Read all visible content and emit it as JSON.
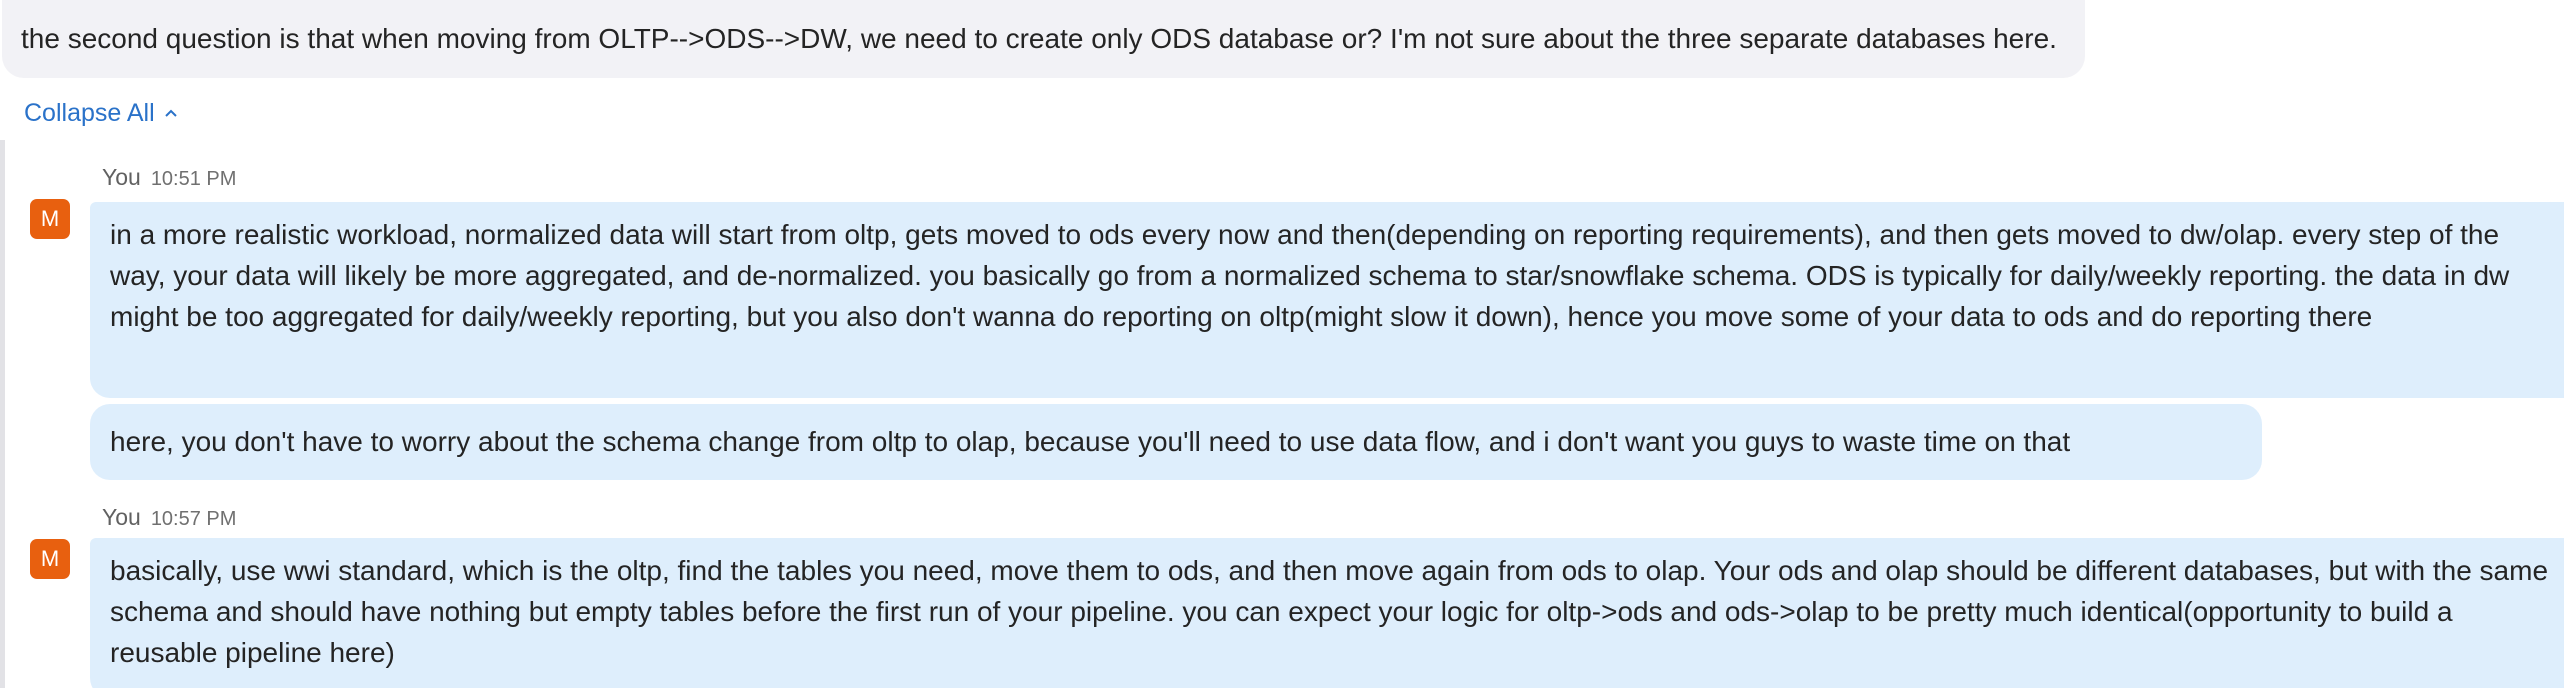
{
  "question": {
    "text": "the second question is that when moving from OLTP-->ODS-->DW, we need to create only ODS database or? I'm not sure about the three separate databases here."
  },
  "thread": {
    "collapse_label": "Collapse All"
  },
  "messages": [
    {
      "sender": "You",
      "time": "10:51 PM",
      "avatar_initial": "M",
      "bubbles": [
        "in a more realistic workload, normalized data will start from oltp, gets moved to ods every now and then(depending on reporting requirements), and then gets moved to dw/olap. every step of the way, your data will likely be more aggregated, and de-normalized. you basically go from a normalized schema to star/snowflake schema. ODS is typically for daily/weekly reporting. the data in dw might be too aggregated for daily/weekly reporting, but you also don't wanna do reporting on oltp(might slow it down), hence you move some of your data to ods and do reporting there",
        "here, you don't have to worry about the schema change from oltp to olap, because you'll need to use data flow, and i don't want you guys to waste time on that"
      ]
    },
    {
      "sender": "You",
      "time": "10:57 PM",
      "avatar_initial": "M",
      "bubbles": [
        "basically, use wwi standard, which is the oltp, find the tables you need, move them to ods, and then move again from ods to olap. Your ods and olap should be different databases, but with the same schema and should have nothing but empty tables before the first run of your pipeline. you can expect your logic for oltp->ods and ods->olap to be pretty much identical(opportunity to build a reusable pipeline here)"
      ]
    }
  ],
  "colors": {
    "bubble_bg": "#deeefc",
    "question_bg": "#f2f2f6",
    "avatar_bg": "#e8600f",
    "link": "#2a72c9"
  }
}
